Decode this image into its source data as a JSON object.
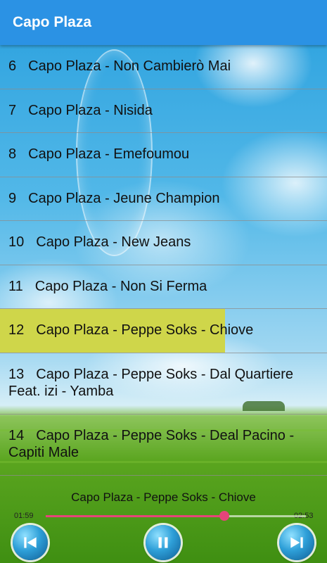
{
  "app": {
    "title": "Capo Plaza"
  },
  "tracks": [
    {
      "num": "6",
      "title": "Capo Plaza - Non Cambierò Mai"
    },
    {
      "num": "7",
      "title": "Capo Plaza - Nisida"
    },
    {
      "num": "8",
      "title": "Capo Plaza - Emefoumou"
    },
    {
      "num": "9",
      "title": "Capo Plaza - Jeune Champion"
    },
    {
      "num": "10",
      "title": "Capo Plaza - New Jeans"
    },
    {
      "num": "11",
      "title": "Capo Plaza - Non Si Ferma"
    },
    {
      "num": "12",
      "title": "Capo Plaza - Peppe Soks - Chiove",
      "selected": true
    },
    {
      "num": "13",
      "title": "Capo Plaza - Peppe Soks - Dal Quartiere Feat. izi - Yamba"
    },
    {
      "num": "14",
      "title": "Capo Plaza - Peppe Soks - Deal Pacino - Capiti Male"
    }
  ],
  "player": {
    "now_playing": "Capo Plaza - Peppe Soks - Chiove",
    "elapsed": "01:59",
    "duration": "02:53",
    "progress_fraction": 0.6875,
    "accent_color": "#e5447a",
    "controls": {
      "previous_icon": "skip-previous-icon",
      "pause_icon": "pause-icon",
      "next_icon": "skip-next-icon"
    }
  },
  "colors": {
    "appbar": "#2b92e4",
    "selected_row": "#cfd64a"
  }
}
